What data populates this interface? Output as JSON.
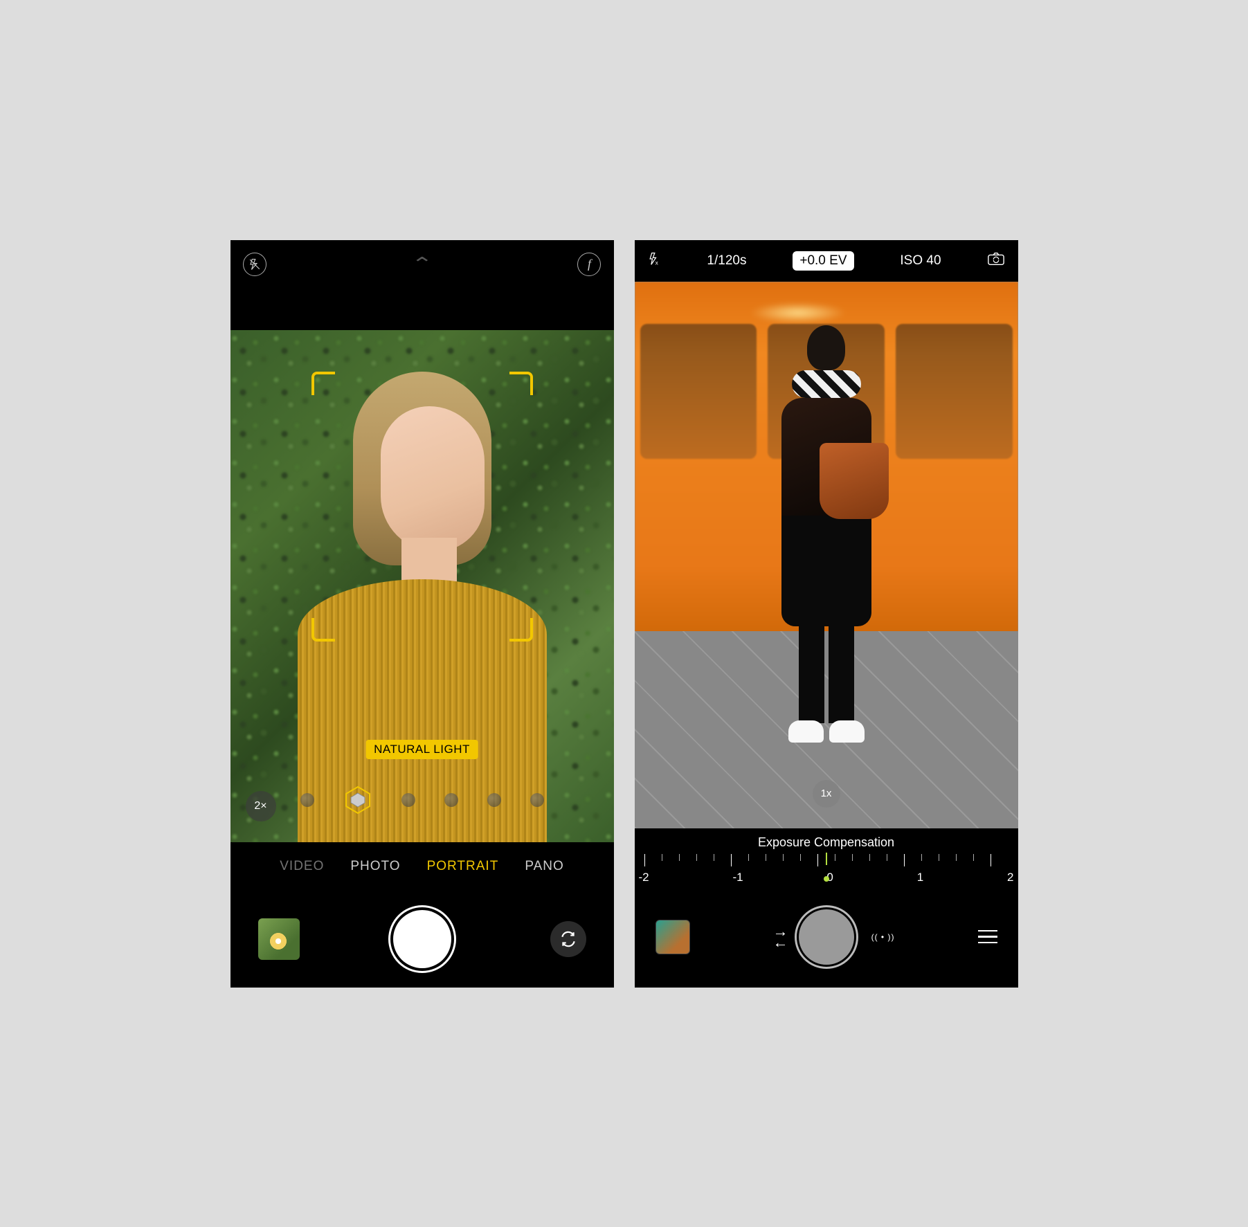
{
  "left": {
    "top": {
      "flash": "off",
      "aperture_icon": "f"
    },
    "lighting_badge": "NATURAL LIGHT",
    "zoom_label": "2×",
    "modes": {
      "video": "VIDEO",
      "photo": "PHOTO",
      "portrait": "PORTRAIT",
      "pano": "PANO"
    }
  },
  "right": {
    "top": {
      "shutter_speed": "1/120s",
      "ev": "+0.0 EV",
      "iso": "ISO 40"
    },
    "zoom_label": "1x",
    "exposure_label": "Exposure Compensation",
    "scale_labels": {
      "n2": "-2",
      "n1": "-1",
      "zero": "0",
      "p1": "1",
      "p2": "2"
    }
  }
}
